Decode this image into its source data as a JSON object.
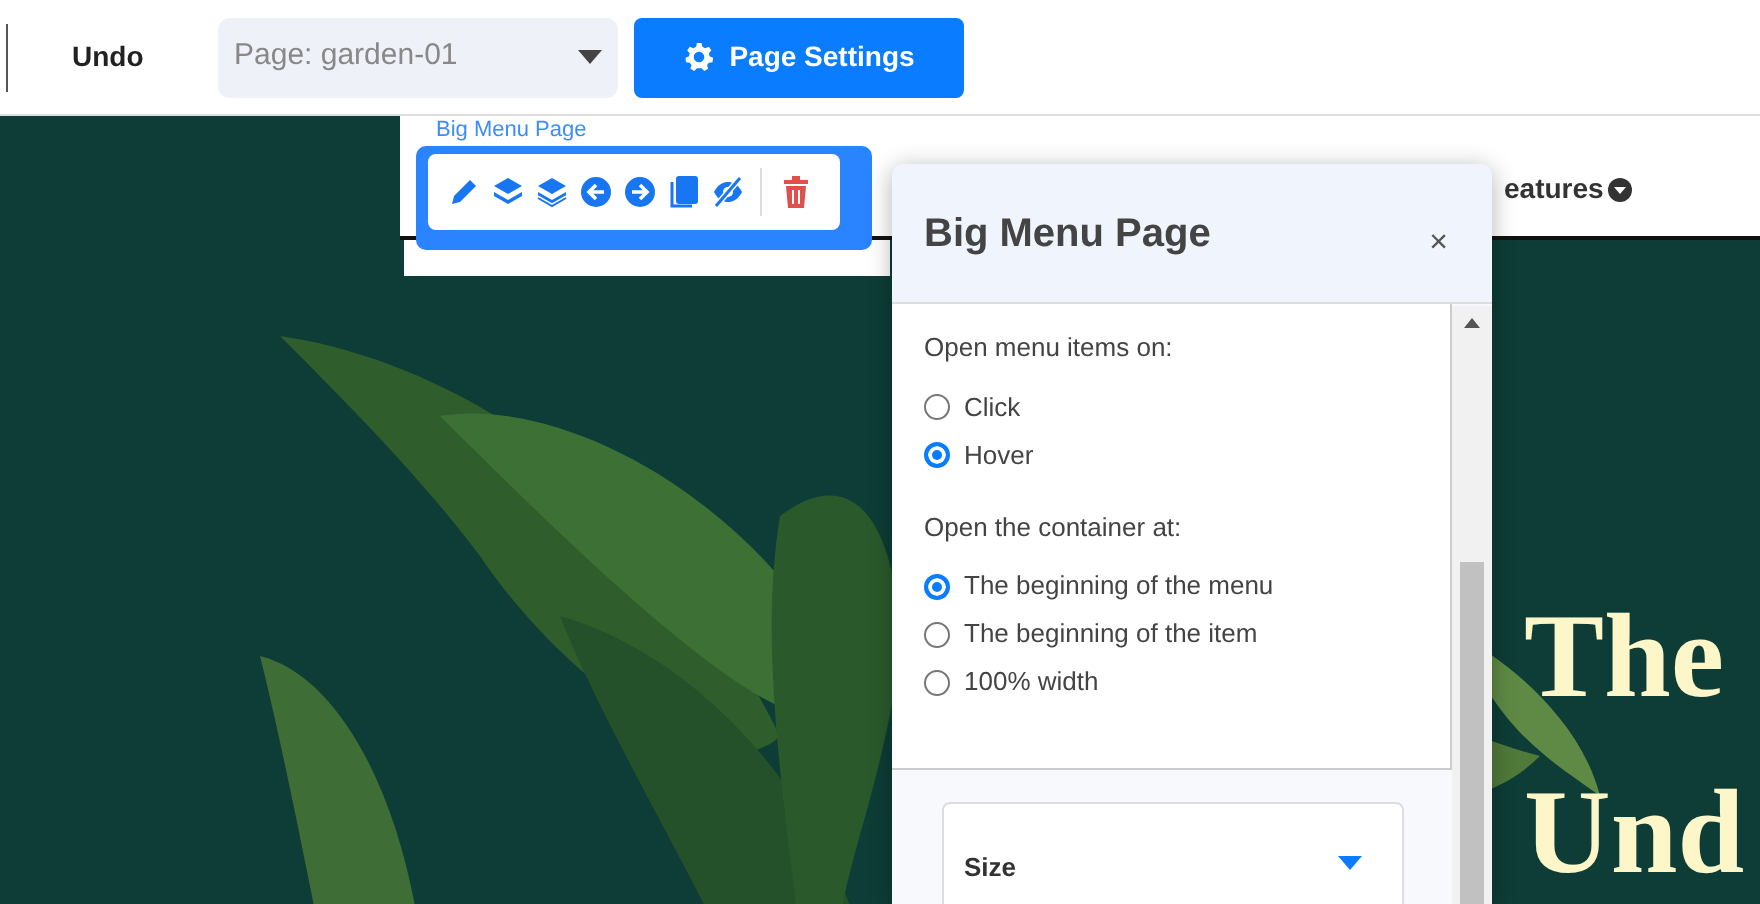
{
  "top_bar": {
    "undo": "Undo",
    "page_select": {
      "placeholder": "Page: garden-01"
    },
    "settings_button": "Page Settings"
  },
  "canvas": {
    "nav_item": "eatures",
    "selection_label": "Big Menu Page",
    "hero_lines": [
      "The",
      "Und"
    ]
  },
  "toolbar": {
    "tools": [
      {
        "kind": "edit"
      },
      {
        "kind": "layers-up"
      },
      {
        "kind": "layers"
      },
      {
        "kind": "left"
      },
      {
        "kind": "right"
      },
      {
        "kind": "copy"
      },
      {
        "kind": "hide"
      },
      {
        "kind": "delete"
      }
    ]
  },
  "panel": {
    "title": "Big Menu Page",
    "close": "×",
    "groups": [
      {
        "label": "Open menu items on:",
        "options": [
          {
            "label": "Click",
            "selected": false
          },
          {
            "label": "Hover",
            "selected": true
          }
        ]
      },
      {
        "label": "Open the container at:",
        "options": [
          {
            "label": "The beginning of the menu",
            "selected": true
          },
          {
            "label": "The beginning of the item",
            "selected": false
          },
          {
            "label": "100% width",
            "selected": false
          }
        ]
      }
    ],
    "size_section": {
      "label": "Size",
      "expanded": false
    }
  }
}
